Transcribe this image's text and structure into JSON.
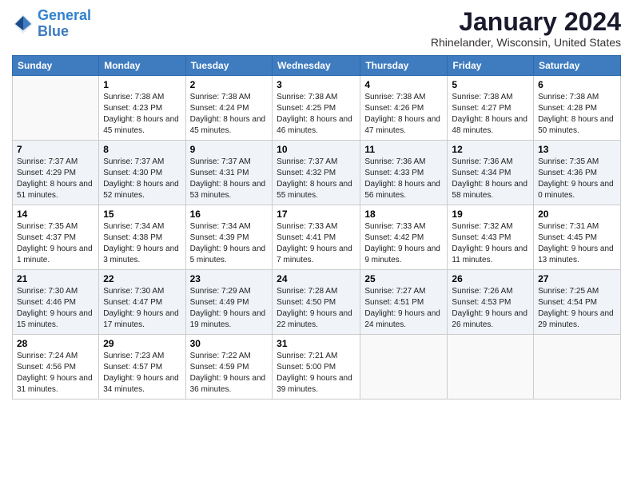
{
  "logo": {
    "line1": "General",
    "line2": "Blue"
  },
  "title": "January 2024",
  "location": "Rhinelander, Wisconsin, United States",
  "weekdays": [
    "Sunday",
    "Monday",
    "Tuesday",
    "Wednesday",
    "Thursday",
    "Friday",
    "Saturday"
  ],
  "weeks": [
    [
      {
        "day": "",
        "sunrise": "",
        "sunset": "",
        "daylight": ""
      },
      {
        "day": "1",
        "sunrise": "Sunrise: 7:38 AM",
        "sunset": "Sunset: 4:23 PM",
        "daylight": "Daylight: 8 hours and 45 minutes."
      },
      {
        "day": "2",
        "sunrise": "Sunrise: 7:38 AM",
        "sunset": "Sunset: 4:24 PM",
        "daylight": "Daylight: 8 hours and 45 minutes."
      },
      {
        "day": "3",
        "sunrise": "Sunrise: 7:38 AM",
        "sunset": "Sunset: 4:25 PM",
        "daylight": "Daylight: 8 hours and 46 minutes."
      },
      {
        "day": "4",
        "sunrise": "Sunrise: 7:38 AM",
        "sunset": "Sunset: 4:26 PM",
        "daylight": "Daylight: 8 hours and 47 minutes."
      },
      {
        "day": "5",
        "sunrise": "Sunrise: 7:38 AM",
        "sunset": "Sunset: 4:27 PM",
        "daylight": "Daylight: 8 hours and 48 minutes."
      },
      {
        "day": "6",
        "sunrise": "Sunrise: 7:38 AM",
        "sunset": "Sunset: 4:28 PM",
        "daylight": "Daylight: 8 hours and 50 minutes."
      }
    ],
    [
      {
        "day": "7",
        "sunrise": "Sunrise: 7:37 AM",
        "sunset": "Sunset: 4:29 PM",
        "daylight": "Daylight: 8 hours and 51 minutes."
      },
      {
        "day": "8",
        "sunrise": "Sunrise: 7:37 AM",
        "sunset": "Sunset: 4:30 PM",
        "daylight": "Daylight: 8 hours and 52 minutes."
      },
      {
        "day": "9",
        "sunrise": "Sunrise: 7:37 AM",
        "sunset": "Sunset: 4:31 PM",
        "daylight": "Daylight: 8 hours and 53 minutes."
      },
      {
        "day": "10",
        "sunrise": "Sunrise: 7:37 AM",
        "sunset": "Sunset: 4:32 PM",
        "daylight": "Daylight: 8 hours and 55 minutes."
      },
      {
        "day": "11",
        "sunrise": "Sunrise: 7:36 AM",
        "sunset": "Sunset: 4:33 PM",
        "daylight": "Daylight: 8 hours and 56 minutes."
      },
      {
        "day": "12",
        "sunrise": "Sunrise: 7:36 AM",
        "sunset": "Sunset: 4:34 PM",
        "daylight": "Daylight: 8 hours and 58 minutes."
      },
      {
        "day": "13",
        "sunrise": "Sunrise: 7:35 AM",
        "sunset": "Sunset: 4:36 PM",
        "daylight": "Daylight: 9 hours and 0 minutes."
      }
    ],
    [
      {
        "day": "14",
        "sunrise": "Sunrise: 7:35 AM",
        "sunset": "Sunset: 4:37 PM",
        "daylight": "Daylight: 9 hours and 1 minute."
      },
      {
        "day": "15",
        "sunrise": "Sunrise: 7:34 AM",
        "sunset": "Sunset: 4:38 PM",
        "daylight": "Daylight: 9 hours and 3 minutes."
      },
      {
        "day": "16",
        "sunrise": "Sunrise: 7:34 AM",
        "sunset": "Sunset: 4:39 PM",
        "daylight": "Daylight: 9 hours and 5 minutes."
      },
      {
        "day": "17",
        "sunrise": "Sunrise: 7:33 AM",
        "sunset": "Sunset: 4:41 PM",
        "daylight": "Daylight: 9 hours and 7 minutes."
      },
      {
        "day": "18",
        "sunrise": "Sunrise: 7:33 AM",
        "sunset": "Sunset: 4:42 PM",
        "daylight": "Daylight: 9 hours and 9 minutes."
      },
      {
        "day": "19",
        "sunrise": "Sunrise: 7:32 AM",
        "sunset": "Sunset: 4:43 PM",
        "daylight": "Daylight: 9 hours and 11 minutes."
      },
      {
        "day": "20",
        "sunrise": "Sunrise: 7:31 AM",
        "sunset": "Sunset: 4:45 PM",
        "daylight": "Daylight: 9 hours and 13 minutes."
      }
    ],
    [
      {
        "day": "21",
        "sunrise": "Sunrise: 7:30 AM",
        "sunset": "Sunset: 4:46 PM",
        "daylight": "Daylight: 9 hours and 15 minutes."
      },
      {
        "day": "22",
        "sunrise": "Sunrise: 7:30 AM",
        "sunset": "Sunset: 4:47 PM",
        "daylight": "Daylight: 9 hours and 17 minutes."
      },
      {
        "day": "23",
        "sunrise": "Sunrise: 7:29 AM",
        "sunset": "Sunset: 4:49 PM",
        "daylight": "Daylight: 9 hours and 19 minutes."
      },
      {
        "day": "24",
        "sunrise": "Sunrise: 7:28 AM",
        "sunset": "Sunset: 4:50 PM",
        "daylight": "Daylight: 9 hours and 22 minutes."
      },
      {
        "day": "25",
        "sunrise": "Sunrise: 7:27 AM",
        "sunset": "Sunset: 4:51 PM",
        "daylight": "Daylight: 9 hours and 24 minutes."
      },
      {
        "day": "26",
        "sunrise": "Sunrise: 7:26 AM",
        "sunset": "Sunset: 4:53 PM",
        "daylight": "Daylight: 9 hours and 26 minutes."
      },
      {
        "day": "27",
        "sunrise": "Sunrise: 7:25 AM",
        "sunset": "Sunset: 4:54 PM",
        "daylight": "Daylight: 9 hours and 29 minutes."
      }
    ],
    [
      {
        "day": "28",
        "sunrise": "Sunrise: 7:24 AM",
        "sunset": "Sunset: 4:56 PM",
        "daylight": "Daylight: 9 hours and 31 minutes."
      },
      {
        "day": "29",
        "sunrise": "Sunrise: 7:23 AM",
        "sunset": "Sunset: 4:57 PM",
        "daylight": "Daylight: 9 hours and 34 minutes."
      },
      {
        "day": "30",
        "sunrise": "Sunrise: 7:22 AM",
        "sunset": "Sunset: 4:59 PM",
        "daylight": "Daylight: 9 hours and 36 minutes."
      },
      {
        "day": "31",
        "sunrise": "Sunrise: 7:21 AM",
        "sunset": "Sunset: 5:00 PM",
        "daylight": "Daylight: 9 hours and 39 minutes."
      },
      {
        "day": "",
        "sunrise": "",
        "sunset": "",
        "daylight": ""
      },
      {
        "day": "",
        "sunrise": "",
        "sunset": "",
        "daylight": ""
      },
      {
        "day": "",
        "sunrise": "",
        "sunset": "",
        "daylight": ""
      }
    ]
  ]
}
